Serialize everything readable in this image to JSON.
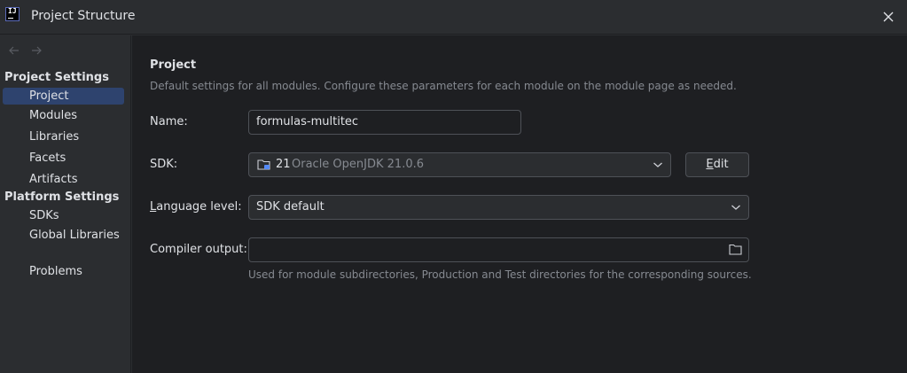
{
  "window": {
    "title": "Project Structure",
    "logo_text": "IJ"
  },
  "sidebar": {
    "sections": [
      {
        "title": "Project Settings",
        "items": [
          "Project",
          "Modules",
          "Libraries",
          "Facets",
          "Artifacts"
        ]
      },
      {
        "title": "Platform Settings",
        "items": [
          "SDKs",
          "Global Libraries"
        ]
      }
    ],
    "extra_items": [
      "Problems"
    ],
    "selected": "Project"
  },
  "main": {
    "title": "Project",
    "description": "Default settings for all modules. Configure these parameters for each module on the module page as needed.",
    "name": {
      "label": "Name:",
      "value": "formulas-multitec"
    },
    "sdk": {
      "label": "SDK:",
      "version": "21",
      "name": "Oracle OpenJDK 21.0.6",
      "edit_button_prefix": "",
      "edit_button_mnemonic": "E",
      "edit_button_rest": "dit"
    },
    "language_level": {
      "label_mnemonic": "L",
      "label_rest": "anguage level:",
      "value": "SDK default"
    },
    "compiler_output": {
      "label": "Compiler output:",
      "value": "",
      "help": "Used for module subdirectories, Production and Test directories for the corresponding sources."
    }
  },
  "icons": {
    "close": "close-icon",
    "back": "arrow-left-icon",
    "forward": "arrow-right-icon",
    "dropdown": "chevron-down-icon",
    "folder": "folder-icon",
    "sdk": "sdk-folder-icon"
  },
  "colors": {
    "selection": "#2e436e",
    "background": "#1e1f22",
    "sidebar": "#2b2d30"
  }
}
